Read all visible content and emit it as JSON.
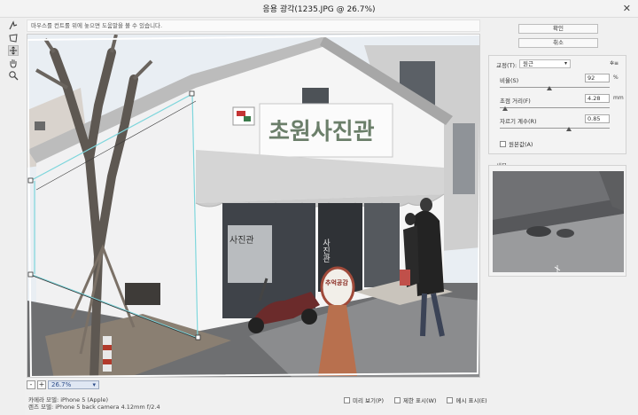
{
  "window": {
    "title": "응용 광각(1235.JPG @ 26.7%)"
  },
  "hint": "마우스를 컨트롤 위에 놓으면 도움말을 볼 수 있습니다.",
  "tools": [
    "constraint-tool",
    "polygon-constraint-tool",
    "move-tool",
    "hand-tool",
    "zoom-tool"
  ],
  "buttons": {
    "ok": "확인",
    "cancel": "취소"
  },
  "correction": {
    "label": "교정(T):",
    "value": "원근",
    "settings_icon": "✲≡",
    "scale": {
      "label": "비율(S)",
      "value": "92",
      "unit": "%",
      "position": 0.45
    },
    "focal": {
      "label": "초점 거리(F)",
      "value": "4.28",
      "unit": "mm",
      "position": 0.05
    },
    "crop": {
      "label": "자르기 계수(R)",
      "value": "0.85",
      "position": 0.63
    },
    "as_shot": "원본값(A)"
  },
  "detail": {
    "label": "세부"
  },
  "zoom": {
    "value": "26.7%",
    "minus": "-",
    "plus": "+"
  },
  "camera": {
    "model": "카메라 모델: iPhone 5 (Apple)",
    "lens": "렌즈 모델: iPhone 5 back camera 4.12mm f/2.4"
  },
  "options": {
    "preview": "미리 보기(P)",
    "show_constraints": "제한 표시(W)",
    "show_mesh": "메시 표시(E)"
  },
  "signboard": {
    "main": "초원사진관",
    "side": "사진관",
    "tag": "추억공감",
    "window_text": "사진관"
  },
  "colors": {
    "accent": "#2b4b88",
    "guide": "#7ed6dc"
  }
}
